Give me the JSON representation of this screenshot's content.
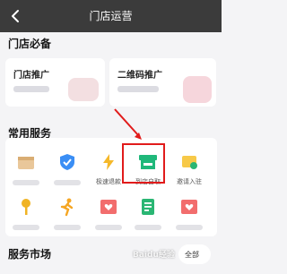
{
  "header": {
    "title": "门店运营"
  },
  "sections": {
    "essentials_title": "门店必备",
    "services_title": "常用服务",
    "market_title": "服务市场"
  },
  "promos": [
    {
      "label": "门店推广"
    },
    {
      "label": "二维码推广"
    }
  ],
  "services": {
    "row1": [
      {
        "icon": "box-icon",
        "label": ""
      },
      {
        "icon": "shield-icon",
        "label": ""
      },
      {
        "icon": "lightning-icon",
        "label": "极速退款"
      },
      {
        "icon": "store-icon",
        "label": "到店自取"
      },
      {
        "icon": "invite-icon",
        "label": "邀请入驻"
      }
    ],
    "row2": [
      {
        "icon": "key-icon",
        "label": ""
      },
      {
        "icon": "runner-icon",
        "label": ""
      },
      {
        "icon": "heart-card-icon",
        "label": ""
      },
      {
        "icon": "document-icon",
        "label": ""
      },
      {
        "icon": "heart-card-icon",
        "label": ""
      }
    ]
  },
  "market": {
    "more_label": "全部"
  },
  "watermark": "Baidu经验",
  "colors": {
    "header_bg": "#3b3b3b",
    "highlight_border": "#e11b1b",
    "store_icon_green": "#1fb87a"
  }
}
